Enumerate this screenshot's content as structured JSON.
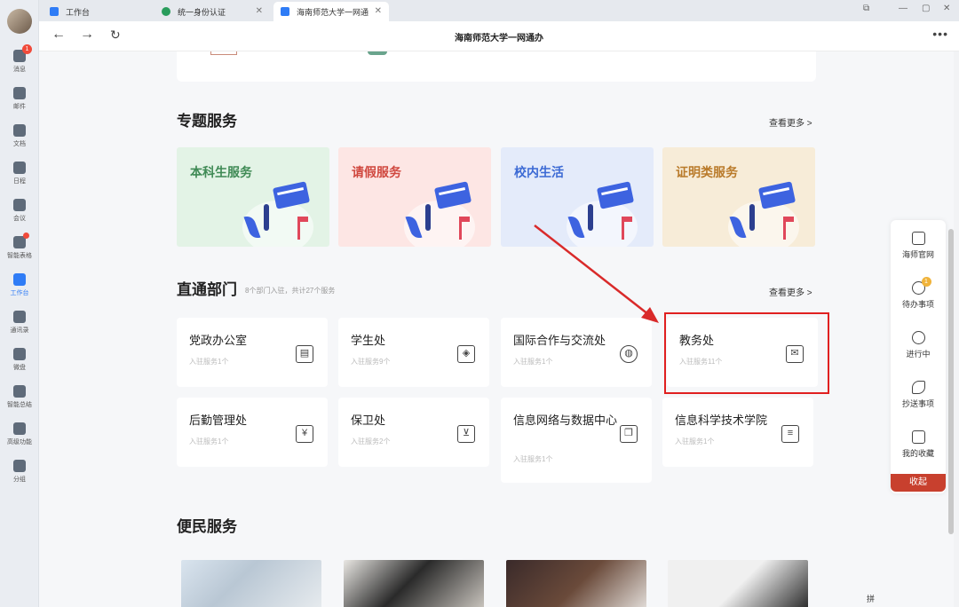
{
  "window": {
    "title": "海南师范大学一网通办"
  },
  "tabs": [
    {
      "label": "工作台",
      "color": "#2f7cf6"
    },
    {
      "label": "统一身份认证",
      "color": "#2a9d5c"
    },
    {
      "label": "海南师范大学一网通",
      "color": "#2f7cf6"
    }
  ],
  "rail": {
    "badge_count": "1",
    "items": [
      {
        "label": "消息",
        "icon": "chat-icon"
      },
      {
        "label": "邮件",
        "icon": "mail-icon"
      },
      {
        "label": "文档",
        "icon": "document-icon"
      },
      {
        "label": "日程",
        "icon": "calendar-icon"
      },
      {
        "label": "会议",
        "icon": "meeting-icon"
      },
      {
        "label": "智能表格",
        "icon": "sheet-icon"
      },
      {
        "label": "工作台",
        "icon": "workbench-icon"
      },
      {
        "label": "通讯录",
        "icon": "contacts-icon"
      },
      {
        "label": "微盘",
        "icon": "drive-icon"
      },
      {
        "label": "智能总结",
        "icon": "ai-summary-icon"
      },
      {
        "label": "高级功能",
        "icon": "advanced-icon"
      },
      {
        "label": "分组",
        "icon": "tag-icon"
      }
    ]
  },
  "sections": {
    "topics": {
      "title": "专题服务",
      "more": "查看更多 >",
      "items": [
        {
          "label": "本科生服务",
          "bg": "#e3f3e6",
          "color": "#3f8a55"
        },
        {
          "label": "请假服务",
          "bg": "#fde6e4",
          "color": "#d0483f"
        },
        {
          "label": "校内生活",
          "bg": "#e4ebfa",
          "color": "#3c6ad4"
        },
        {
          "label": "证明类服务",
          "bg": "#f7ecd8",
          "color": "#b97a2a"
        }
      ]
    },
    "departments": {
      "title": "直通部门",
      "subtitle": "8个部门入驻，共计27个服务",
      "more": "查看更多 >",
      "items": [
        {
          "name": "党政办公室",
          "count": "入驻服务1个",
          "icon": "id-card-icon",
          "glyph": "▤"
        },
        {
          "name": "学生处",
          "count": "入驻服务9个",
          "icon": "handshake-icon",
          "glyph": "◈"
        },
        {
          "name": "国际合作与交流处",
          "count": "入驻服务1个",
          "icon": "globe-icon",
          "glyph": "◍"
        },
        {
          "name": "教务处",
          "count": "入驻服务11个",
          "icon": "envelope-icon",
          "glyph": "✉"
        },
        {
          "name": "后勤管理处",
          "count": "入驻服务1个",
          "icon": "yuan-tray-icon",
          "glyph": "¥"
        },
        {
          "name": "保卫处",
          "count": "入驻服务2个",
          "icon": "cart-icon",
          "glyph": "⊻"
        },
        {
          "name": "信息网络与数据中心",
          "count": "入驻服务1个",
          "icon": "book-icon",
          "glyph": "❐"
        },
        {
          "name": "信息科学技术学院",
          "count": "入驻服务1个",
          "icon": "notepad-icon",
          "glyph": "≡"
        }
      ]
    },
    "convenience": {
      "title": "便民服务"
    }
  },
  "float_panel": {
    "badge": "1",
    "items": [
      {
        "label": "海师官网",
        "icon": "monitor-icon"
      },
      {
        "label": "待办事项",
        "icon": "clock-icon"
      },
      {
        "label": "进行中",
        "icon": "progress-icon"
      },
      {
        "label": "抄送事项",
        "icon": "rocket-icon"
      },
      {
        "label": "我的收藏",
        "icon": "thumbs-up-icon"
      }
    ],
    "collapse": "收起"
  },
  "ime": {
    "label": "拼"
  }
}
